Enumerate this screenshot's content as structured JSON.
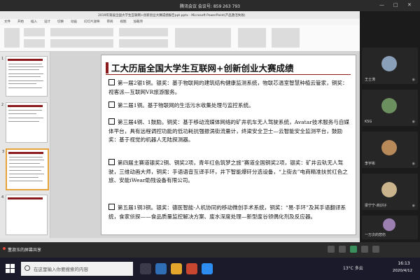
{
  "meeting": {
    "title": "腾讯会议 会议号: 859 263 793",
    "share_notice": "董淑玉的屏幕共享"
  },
  "ppt": {
    "window_title": "2019年第届全国大学生互联网+创新创业大赛成绩报告ppt.pptx - Microsoft PowerPoint(产品激活失败)",
    "tabs": [
      "文件",
      "开始",
      "插入",
      "设计",
      "切换",
      "动画",
      "幻灯片放映",
      "审阅",
      "视图",
      "加载项"
    ],
    "thumbnails": [
      {
        "num": "1"
      },
      {
        "num": "2"
      },
      {
        "num": "3"
      },
      {
        "num": "4"
      }
    ],
    "slide": {
      "title": "工大历届全国大学生互联网+创新创业大赛成绩",
      "items": [
        "第一届2银1铜。银奖：基于物联网的建筑结构健康监测系统，物联芯温室智慧种植云管家，铜奖：视客派—互联网VR旅游服务。",
        "第二届1铜。基于物联网的生活污水收集处理与监控系统。",
        "第三届4铜、1鼓励。铜奖：基于移动流媒体网络的矿井机车无人驾驶系统，Avatar技术服务与自媒体平台，具有远程调控功能的低功耗抗强振涡街流量计，终梁安全卫士—云智能安全监测平台，鼓励奖：基于视觉的机器人无陆探测器。",
        "第四届主赛道银奖2铜、铜奖2项，青年红色筑梦之旅”赛道全国铜奖2项，银奖：矿井云轨无人驾驶，三维动画大师，铜奖：手语语音互译手环，井下智能爆矸分选设备，“上街去”电商精准扶贫红色之旅、安能iWear助残设备有限公司。",
        "第五届1铜3铜。银奖：德医智能-人机协同的移动微创手术系统，铜奖：“易·手环”及其手语翻译系统，食家侦探——食品质量监控解决方案、废水深度处理—新型废谷领偶化剂及反应器。"
      ]
    }
  },
  "participants": [
    {
      "name": "王士涛"
    },
    {
      "name": "KSG"
    },
    {
      "name": "李宇彬"
    },
    {
      "name": "梁宁宁-商训子"
    },
    {
      "name": "一万次的悲伤"
    }
  ],
  "taskbar": {
    "search_placeholder": "在这里输入你要搜索的内容",
    "weather": "13°C 多云",
    "time": "16:13",
    "date": "2020/4/12"
  },
  "colors": {
    "slide_accent": "#8b1a1a",
    "selected_thumb": "#e6a33c"
  }
}
